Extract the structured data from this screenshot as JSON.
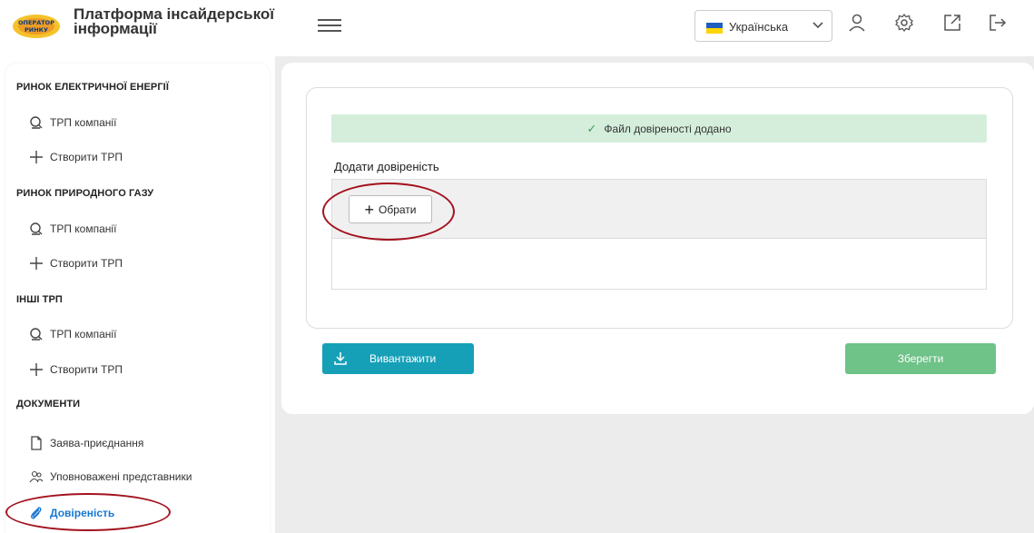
{
  "header": {
    "logo_text": "ОПЕРАТОР РИНКУ",
    "title": "Платформа інсайдерської інформації",
    "language": "Українська"
  },
  "sidebar": {
    "sections": [
      {
        "title": "РИНОК ЕЛЕКТРИЧНОЇ ЕНЕРГІЇ",
        "items": [
          {
            "label": "ТРП компанії",
            "icon": "search-icon"
          },
          {
            "label": "Створити ТРП",
            "icon": "plus-icon"
          }
        ]
      },
      {
        "title": "РИНОК ПРИРОДНОГО ГАЗУ",
        "items": [
          {
            "label": "ТРП компанії",
            "icon": "search-icon"
          },
          {
            "label": "Створити ТРП",
            "icon": "plus-icon"
          }
        ]
      },
      {
        "title": "ІНШІ ТРП",
        "items": [
          {
            "label": "ТРП компанії",
            "icon": "search-icon"
          },
          {
            "label": "Створити ТРП",
            "icon": "plus-icon"
          }
        ]
      },
      {
        "title": "ДОКУМЕНТИ",
        "items": [
          {
            "label": "Заява-приєднання",
            "icon": "document-icon"
          },
          {
            "label": "Уповноважені представники",
            "icon": "users-icon"
          },
          {
            "label": "Довіреність",
            "icon": "paperclip-icon",
            "active": true
          }
        ]
      }
    ]
  },
  "main": {
    "success_message": "Файл довіреності додано",
    "add_label": "Додати довіреність",
    "choose_button": "Обрати",
    "download_button": "Вивантажити",
    "save_button": "Зберегти"
  },
  "colors": {
    "accent_blue": "#1677d2",
    "download_teal": "#16a0b8",
    "save_green": "#6fc288",
    "success_bg": "#d4eedb",
    "annotation_red": "#a3121e"
  }
}
